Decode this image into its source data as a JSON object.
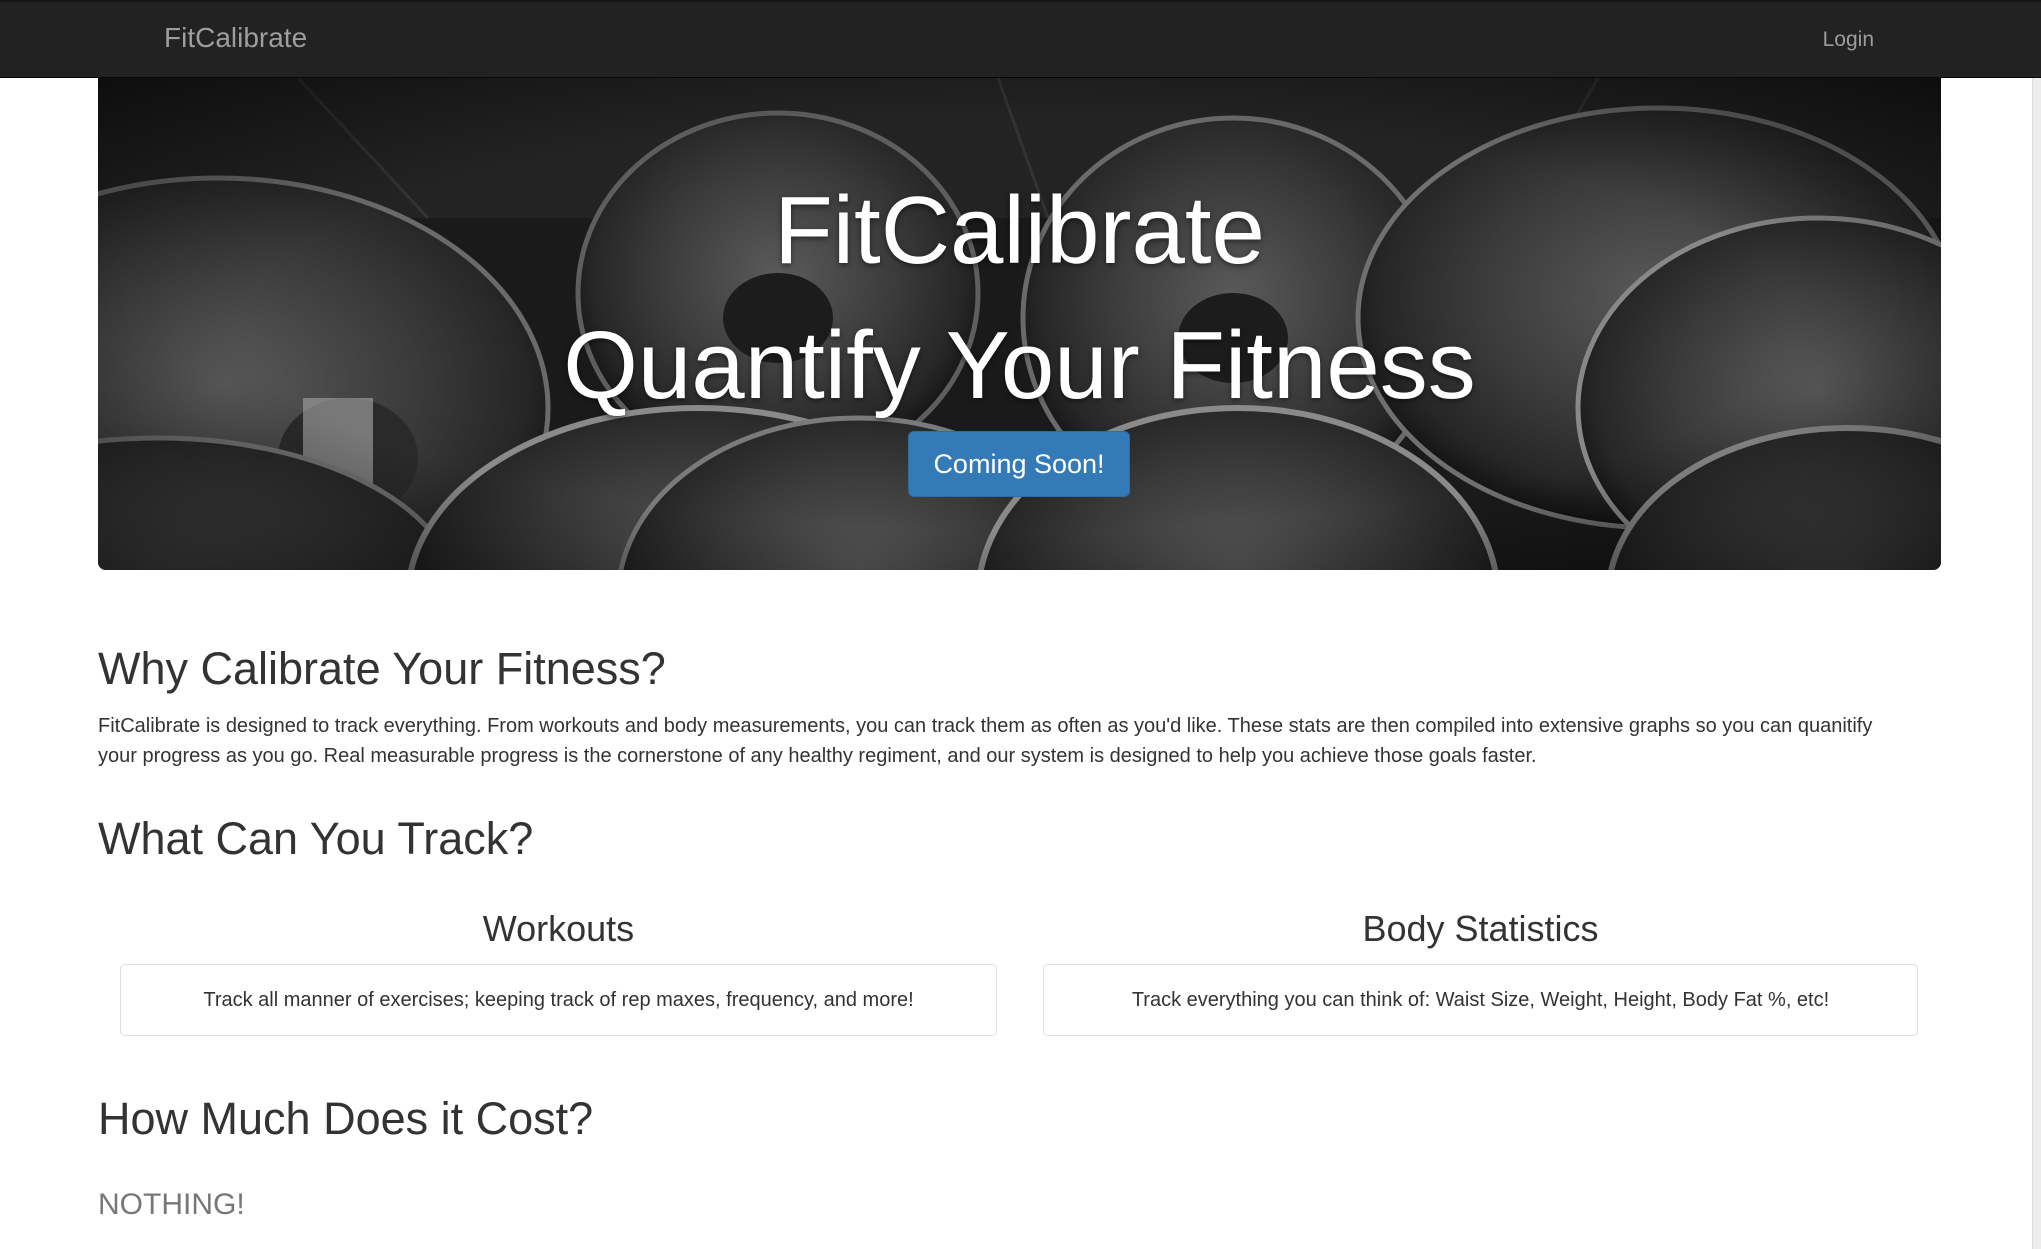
{
  "navbar": {
    "brand": "FitCalibrate",
    "login": "Login"
  },
  "hero": {
    "title": "FitCalibrate",
    "subtitle": "Quantify Your Fitness",
    "button": "Coming Soon!"
  },
  "why": {
    "heading": "Why Calibrate Your Fitness?",
    "text": "FitCalibrate is designed to track everything. From workouts and body measurements, you can track them as often as you'd like. These stats are then compiled into extensive graphs so you can quanitify your progress as you go. Real measurable progress is the cornerstone of any healthy regiment, and our system is designed to help you achieve those goals faster."
  },
  "track": {
    "heading": "What Can You Track?",
    "columns": [
      {
        "title": "Workouts",
        "text": "Track all manner of exercises; keeping track of rep maxes, frequency, and more!"
      },
      {
        "title": "Body Statistics",
        "text": "Track everything you can think of: Waist Size, Weight, Height, Body Fat %, etc!"
      }
    ]
  },
  "cost": {
    "heading": "How Much Does it Cost?",
    "answer": "NOTHING!"
  },
  "colors": {
    "navbar": "#222222",
    "nav_text": "#9d9d9d",
    "button": "#337ab7",
    "muted": "#777777"
  }
}
